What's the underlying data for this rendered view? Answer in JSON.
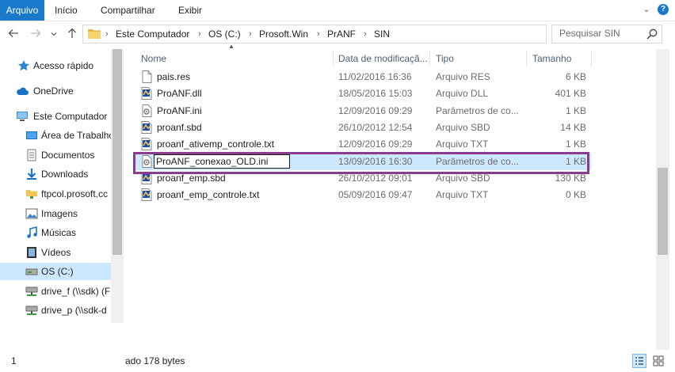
{
  "ribbon": {
    "tabs": [
      {
        "label": "Arquivo",
        "active": true
      },
      {
        "label": "Início"
      },
      {
        "label": "Compartilhar"
      },
      {
        "label": "Exibir"
      }
    ],
    "help": "?"
  },
  "nav": {
    "back_icon": "arrow-left-icon",
    "forward_icon": "arrow-right-icon",
    "recent_icon": "chevron-down-icon",
    "up_icon": "arrow-up-icon"
  },
  "address": {
    "crumbs": [
      "Este Computador",
      "OS (C:)",
      "Prosoft.Win",
      "PrANF",
      "SIN"
    ]
  },
  "search": {
    "placeholder": "Pesquisar SIN"
  },
  "sidebar": {
    "items": [
      {
        "label": "Acesso rápido",
        "icon": "star-icon"
      },
      {
        "label": "OneDrive",
        "icon": "cloud-icon"
      },
      {
        "label": "Este Computador",
        "icon": "computer-icon"
      },
      {
        "label": "Área de Trabalho",
        "icon": "desktop-icon"
      },
      {
        "label": "Documentos",
        "icon": "documents-icon"
      },
      {
        "label": "Downloads",
        "icon": "download-icon"
      },
      {
        "label": "ftpcol.prosoft.cc",
        "icon": "network-folder-icon"
      },
      {
        "label": "Imagens",
        "icon": "pictures-icon"
      },
      {
        "label": "Músicas",
        "icon": "music-icon"
      },
      {
        "label": "Vídeos",
        "icon": "videos-icon"
      },
      {
        "label": "OS (C:)",
        "icon": "drive-icon",
        "selected": true
      },
      {
        "label": "drive_f (\\\\sdk) (F",
        "icon": "network-drive-icon"
      },
      {
        "label": "drive_p (\\\\sdk-d",
        "icon": "network-drive-icon"
      }
    ]
  },
  "columns": {
    "name": "Nome",
    "date": "Data de modificaçã...",
    "type": "Tipo",
    "size": "Tamanho"
  },
  "files": [
    {
      "name": "pais.res",
      "date": "11/02/2016 16:36",
      "type": "Arquivo RES",
      "size": "6 KB",
      "icon": "blank-file-icon"
    },
    {
      "name": "ProANF.dll",
      "date": "18/05/2016 15:03",
      "type": "Arquivo DLL",
      "size": "401 KB",
      "icon": "app-file-icon"
    },
    {
      "name": "ProANF.ini",
      "date": "12/09/2016 09:29",
      "type": "Parâmetros de co...",
      "size": "1 KB",
      "icon": "settings-file-icon"
    },
    {
      "name": "proanf.sbd",
      "date": "26/10/2012 12:54",
      "type": "Arquivo SBD",
      "size": "14 KB",
      "icon": "app-file-icon"
    },
    {
      "name": "proanf_ativemp_controle.txt",
      "date": "12/09/2016 09:29",
      "type": "Arquivo TXT",
      "size": "1 KB",
      "icon": "app-file-icon"
    },
    {
      "name": "ProANF_conexao_OLD.ini",
      "date": "13/09/2016 16:30",
      "type": "Parâmetros de co...",
      "size": "1 KB",
      "icon": "settings-file-icon",
      "selected": true,
      "renaming": true
    },
    {
      "name": "proanf_emp.sbd",
      "date": "26/10/2012 09:01",
      "type": "Arquivo SBD",
      "size": "130 KB",
      "icon": "app-file-icon"
    },
    {
      "name": "proanf_emp_controle.txt",
      "date": "05/09/2016 09:47",
      "type": "Arquivo TXT",
      "size": "0 KB",
      "icon": "app-file-icon"
    }
  ],
  "status": {
    "count": "1",
    "selection": "ado  178 bytes"
  },
  "colors": {
    "accent": "#1979ca",
    "selection": "#cce8ff",
    "highlight_box": "#8a3c8f"
  }
}
